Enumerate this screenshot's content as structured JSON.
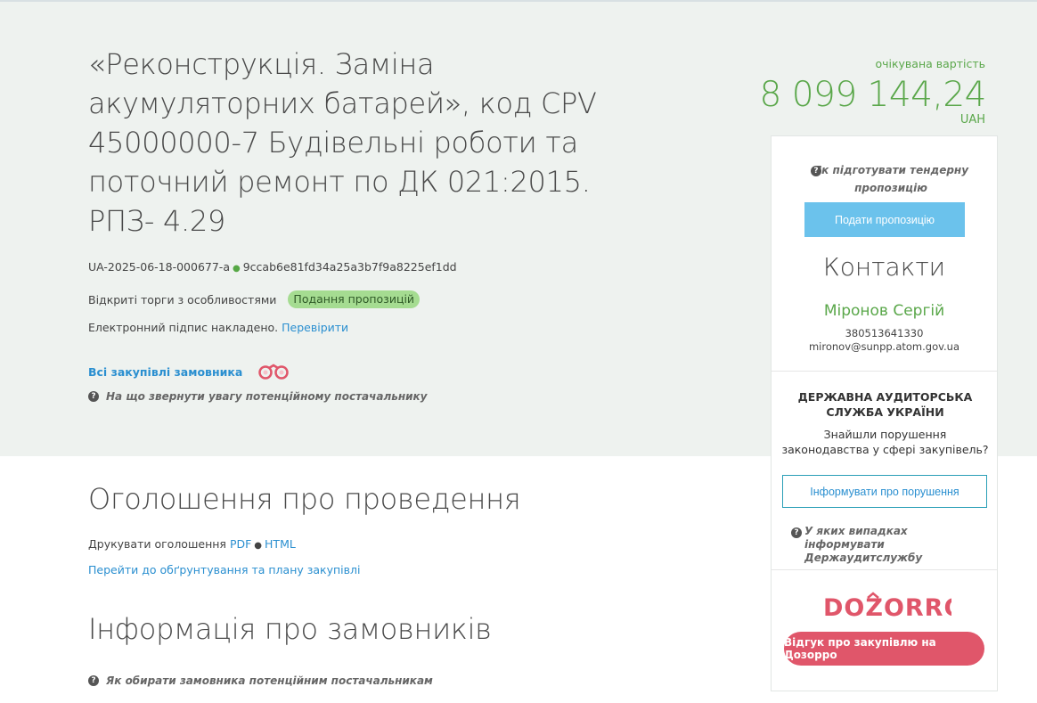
{
  "tender": {
    "title": "«Реконструкція. Заміна акумуляторних батарей», код CPV 45000000-7 Будівельні роботи та поточний ремонт по ДК 021:2015. РПЗ- 4.29",
    "id": "UA-2025-06-18-000677-a",
    "hash": "9ccab6e81fd34a25a3b7f9a8225ef1dd",
    "procedure_type": "Відкриті торги з особливостями",
    "status_badge": "Подання пропозицій",
    "signature_text": "Електронний підпис накладено.",
    "signature_link": "Перевірити",
    "all_purchases_link": "Всі закупівлі замовника",
    "hint_supplier": "На що звернути увагу потенційному постачальнику"
  },
  "value": {
    "label": "очікувана вартість",
    "amount": "8 099 144,24",
    "currency": "UAH"
  },
  "announcement": {
    "heading": "Оголошення про проведення",
    "print_label": "Друкувати оголошення",
    "pdf_link": "PDF",
    "html_link": "HTML",
    "plan_link": "Перейти до обґрунтування та плану закупівлі"
  },
  "customers": {
    "heading": "Інформація про замовників",
    "hint": "Як обирати замовника потенційним постачальникам"
  },
  "sidebar": {
    "prepare_hint": "Як підготувати тендерну пропозицію",
    "submit_button": "Подати пропозицію",
    "contacts_title": "Контакти",
    "contact_name": "Міронов Сергій",
    "contact_phone": "380513641330",
    "contact_email": "mironov@sunpp.atom.gov.ua",
    "audit_title": "ДЕРЖАВНА АУДИТОРСЬКА СЛУЖБА УКРАЇНИ",
    "audit_text": "Знайшли порушення законодавства у сфері закупівель?",
    "report_button": "Інформувати про порушення",
    "audit_hint": "У яких випадках інформувати Держаудитслужбу",
    "dozorro_logo": "DOZORRO",
    "dozorro_button": "Відгук про закупівлю на Дозорро"
  },
  "colors": {
    "accent_green": "#5aa74a",
    "link_blue": "#2a8fd0",
    "submit_blue": "#6bc2ec",
    "dozorro_red": "#e0566a",
    "hero_bg": "#eef2ef"
  }
}
